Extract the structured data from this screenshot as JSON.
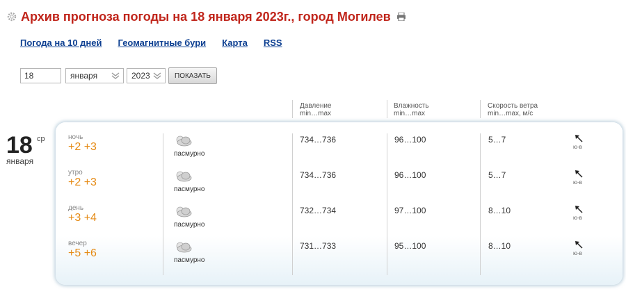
{
  "header": {
    "title": "Архив прогноза погоды на 18 января 2023г., город Могилев",
    "gear_icon": "gear-icon",
    "print_icon": "printer-icon"
  },
  "nav": [
    {
      "label": "Погода на 10 дней"
    },
    {
      "label": "Геомагнитные бури"
    },
    {
      "label": "Карта"
    },
    {
      "label": "RSS"
    }
  ],
  "form": {
    "day": "18",
    "month": "января",
    "year": "2023",
    "button": "ПОКАЗАТЬ"
  },
  "columns": {
    "pressure": {
      "title": "Давление",
      "sub": "min…max"
    },
    "humidity": {
      "title": "Влажность",
      "sub": "min…max"
    },
    "wind": {
      "title": "Скорость ветра",
      "sub": "min…max, м/с"
    }
  },
  "date": {
    "day": "18",
    "weekday": "ср",
    "month": "января"
  },
  "rows": [
    {
      "tod": "ночь",
      "temp": "+2 +3",
      "cond": "пасмурно",
      "pressure": "734…736",
      "humidity": "96…100",
      "wind": "5…7",
      "dir": "ю-в"
    },
    {
      "tod": "утро",
      "temp": "+2 +3",
      "cond": "пасмурно",
      "pressure": "734…736",
      "humidity": "96…100",
      "wind": "5…7",
      "dir": "ю-в"
    },
    {
      "tod": "день",
      "temp": "+3 +4",
      "cond": "пасмурно",
      "pressure": "732…734",
      "humidity": "97…100",
      "wind": "8…10",
      "dir": "ю-в"
    },
    {
      "tod": "вечер",
      "temp": "+5 +6",
      "cond": "пасмурно",
      "pressure": "731…733",
      "humidity": "95…100",
      "wind": "8…10",
      "dir": "ю-в"
    }
  ],
  "colors": {
    "title": "#c0251b",
    "link": "#0d3f91",
    "temperature": "#e58a14"
  }
}
